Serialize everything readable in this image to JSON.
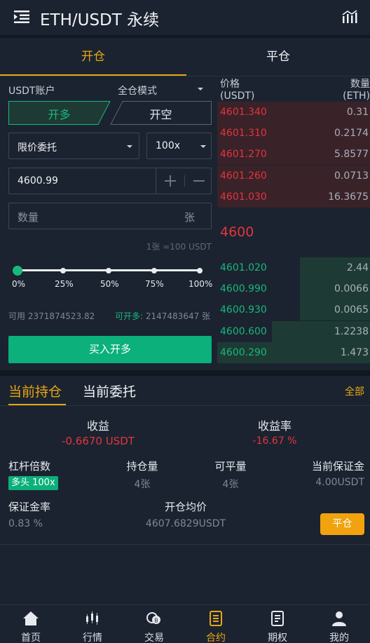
{
  "header": {
    "title": "ETH/USDT 永续"
  },
  "tabs": {
    "open": "开仓",
    "close": "平仓"
  },
  "form": {
    "account": "USDT账户",
    "margin_mode": "全仓模式",
    "long_label": "开多",
    "short_label": "开空",
    "order_type": "限价委托",
    "leverage": "100x",
    "price": "4600.99",
    "qty_placeholder": "数量",
    "qty_unit": "张",
    "contract_note": "1张 =100 USDT",
    "slider_marks": [
      "0%",
      "25%",
      "50%",
      "75%",
      "100%"
    ],
    "slider_value": 0,
    "available_label": "可用",
    "available_value": "2371874523.82",
    "can_open_label": "可开多:",
    "can_open_value": "2147483647 张",
    "submit_label": "买入开多"
  },
  "orderbook": {
    "price_header": "价格\n(USDT)",
    "qty_header": "数量\n(ETH)",
    "asks": [
      {
        "price": "4601.340",
        "qty": "0.31",
        "depth": 1.0
      },
      {
        "price": "4601.310",
        "qty": "0.2174",
        "depth": 1.0
      },
      {
        "price": "4601.270",
        "qty": "5.8577",
        "depth": 1.0
      },
      {
        "price": "4601.260",
        "qty": "0.0713",
        "depth": 1.0
      },
      {
        "price": "4601.030",
        "qty": "16.3675",
        "depth": 1.0
      }
    ],
    "last_price": "4600",
    "bids": [
      {
        "price": "4601.020",
        "qty": "2.44",
        "depth": 0.46
      },
      {
        "price": "4600.990",
        "qty": "0.0066",
        "depth": 0.46
      },
      {
        "price": "4600.930",
        "qty": "0.0065",
        "depth": 0.46
      },
      {
        "price": "4600.600",
        "qty": "1.2238",
        "depth": 0.64
      },
      {
        "price": "4600.290",
        "qty": "1.473",
        "depth": 1.0
      }
    ]
  },
  "positions": {
    "tab_current": "当前持仓",
    "tab_orders": "当前委托",
    "all_label": "全部",
    "pnl_label": "收益",
    "pnl_value": "-0.6670 USDT",
    "roe_label": "收益率",
    "roe_value": "-16.67 %",
    "leverage_label": "杠杆倍数",
    "leverage_badge": "多头 100x",
    "hold_label": "持仓量",
    "hold_value": "4张",
    "closable_label": "可平量",
    "closable_value": "4张",
    "margin_label": "当前保证金",
    "margin_value": "4.00USDT",
    "margin_rate_label": "保证金率",
    "margin_rate_value": "0.83 %",
    "avg_price_label": "开仓均价",
    "avg_price_value": "4607.6829USDT",
    "close_button": "平仓"
  },
  "nav": [
    "首页",
    "行情",
    "交易",
    "合约",
    "期权",
    "我的"
  ],
  "colors": {
    "accent": "#e8a712",
    "buy": "#18b87a",
    "sell": "#e2353d",
    "background": "#1b2330"
  }
}
